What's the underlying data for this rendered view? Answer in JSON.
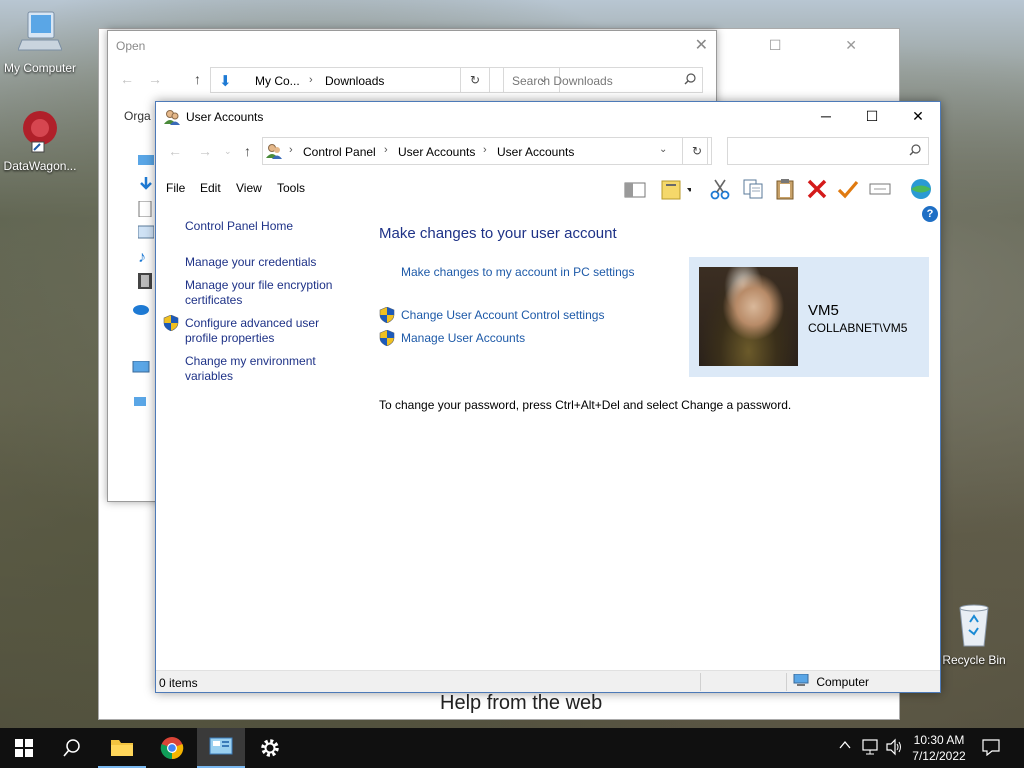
{
  "desktop": {
    "icons": [
      {
        "label": "My Computer"
      },
      {
        "label": "DataWagon..."
      },
      {
        "label": "Recycle Bin"
      }
    ]
  },
  "open_window": {
    "title": "Open",
    "path": [
      "My Co...",
      "Downloads"
    ],
    "search_placeholder": "Search Downloads",
    "organize": "Orga"
  },
  "background_window": {
    "help_text": "Help from the web"
  },
  "user_accounts": {
    "title": "User Accounts",
    "breadcrumb": [
      "Control Panel",
      "User Accounts",
      "User Accounts"
    ],
    "menu": [
      "File",
      "Edit",
      "View",
      "Tools"
    ],
    "left_pane": {
      "home": "Control Panel Home",
      "links": [
        "Manage your credentials",
        "Manage your file encryption certificates",
        "Configure advanced user profile properties",
        "Change my environment variables"
      ]
    },
    "main": {
      "heading": "Make changes to your user account",
      "pc_settings_link": "Make changes to my account in PC settings",
      "uac_link": "Change User Account Control settings",
      "manage_link": "Manage User Accounts",
      "password_info": "To change your password, press Ctrl+Alt+Del and select Change a password."
    },
    "user": {
      "name": "VM5",
      "domain": "COLLABNET\\VM5"
    },
    "status": {
      "items": "0 items",
      "location": "Computer"
    }
  },
  "taskbar": {
    "time": "10:30 AM",
    "date": "7/12/2022"
  },
  "colors": {
    "link": "#1e5aa8",
    "heading": "#1e3287",
    "user_card_bg": "#dce9f7",
    "taskbar_bg": "#101010"
  }
}
